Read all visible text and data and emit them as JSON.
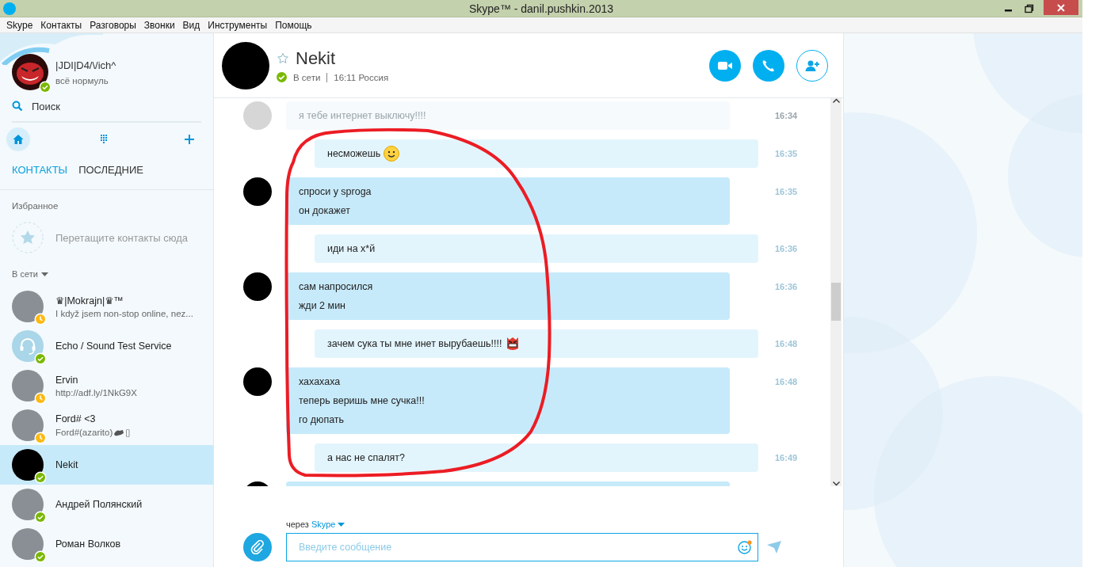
{
  "window": {
    "title": "Skype™ - danil.pushkin.2013"
  },
  "menu": [
    "Skype",
    "Контакты",
    "Разговоры",
    "Звонки",
    "Вид",
    "Инструменты",
    "Помощь"
  ],
  "profile": {
    "name": "|JDI|D4/\\/ich^",
    "mood": "всё нормуль",
    "status": {
      "kind": "online",
      "color": "#7ab800"
    }
  },
  "search": {
    "label": "Поиск"
  },
  "nav": [
    {
      "kind": "home",
      "selected": true
    },
    {
      "kind": "dialpad",
      "selected": false
    },
    {
      "kind": "add",
      "selected": false
    }
  ],
  "tabs": [
    {
      "label": "КОНТАКТЫ",
      "selected": true
    },
    {
      "label": "ПОСЛЕДНИЕ",
      "selected": false
    }
  ],
  "favorites": {
    "heading": "Избранное",
    "placeholder": "Перетащите контакты сюда"
  },
  "group": {
    "label": "В сети",
    "expanded": true
  },
  "contacts": [
    {
      "kind": "photo",
      "name": "♛|Mokrajn|♛™",
      "mood": "I když jsem non-stop online, nez...",
      "status": {
        "kind": "away",
        "color": "#fdb913"
      },
      "selected": false
    },
    {
      "kind": "headset",
      "name": "Echo / Sound Test Service",
      "status": {
        "kind": "online",
        "color": "#7ab800"
      },
      "selected": false
    },
    {
      "kind": "photo",
      "name": "Ervin",
      "mood": "http://adf.ly/1NkG9X",
      "status": {
        "kind": "away",
        "color": "#fdb913"
      },
      "selected": false
    },
    {
      "kind": "photo",
      "name": "Ford#  <3",
      "mood": "Ford#(azarito)",
      "mood_emoticon": true,
      "mood_tail": "▯",
      "status": {
        "kind": "away",
        "color": "#fdb913"
      },
      "selected": false
    },
    {
      "kind": "hidden",
      "name": "Nekit",
      "status": {
        "kind": "online",
        "color": "#7ab800"
      },
      "selected": true
    },
    {
      "kind": "photo",
      "name": "Андрей Полянский",
      "status": {
        "kind": "online",
        "color": "#7ab800"
      },
      "selected": false
    },
    {
      "kind": "photo",
      "name": "Роман Волков",
      "status": {
        "kind": "online",
        "color": "#7ab800"
      },
      "selected": false
    }
  ],
  "conversation": {
    "name": "Nekit",
    "starred": false,
    "status": {
      "kind": "online",
      "color": "#7ab800"
    },
    "presence": "В сети",
    "local_time": "16:11 Россия"
  },
  "actions": [
    {
      "kind": "video"
    },
    {
      "kind": "call"
    },
    {
      "kind": "add-contact"
    }
  ],
  "messages": [
    {
      "kind": "incoming",
      "faded": true,
      "lines": [
        "я тебе интернет выключу!!!!"
      ],
      "time": "16:34"
    },
    {
      "kind": "outgoing",
      "faded": false,
      "lines": [
        "несможешь"
      ],
      "emoticons": [
        {
          "kind": "smile"
        }
      ],
      "time": "16:35"
    },
    {
      "kind": "incoming",
      "faded": false,
      "lines": [
        "спроси у sproga",
        "он докажет"
      ],
      "time": "16:35"
    },
    {
      "kind": "outgoing",
      "faded": false,
      "lines": [
        "иди на х*й"
      ],
      "time": "16:36"
    },
    {
      "kind": "incoming",
      "faded": false,
      "lines": [
        "сам напросился",
        "жди 2 мин"
      ],
      "time": "16:36"
    },
    {
      "kind": "outgoing",
      "faded": false,
      "lines": [
        "зачем сука ты мне инет вырубаешь!!!!"
      ],
      "emoticons": [
        {
          "kind": "angry"
        }
      ],
      "time": "16:48"
    },
    {
      "kind": "incoming",
      "faded": false,
      "lines": [
        "хахахаха",
        "теперь веришь мне сучка!!!",
        "го дюпать"
      ],
      "time": "16:48"
    },
    {
      "kind": "outgoing",
      "faded": false,
      "lines": [
        "а нас не спалят?"
      ],
      "time": "16:49"
    },
    {
      "kind": "incoming",
      "faded": false
    }
  ],
  "composer": {
    "via_label": "через",
    "via_service": "Skype",
    "placeholder": "Введите сообщение",
    "emoji_notification": true
  }
}
